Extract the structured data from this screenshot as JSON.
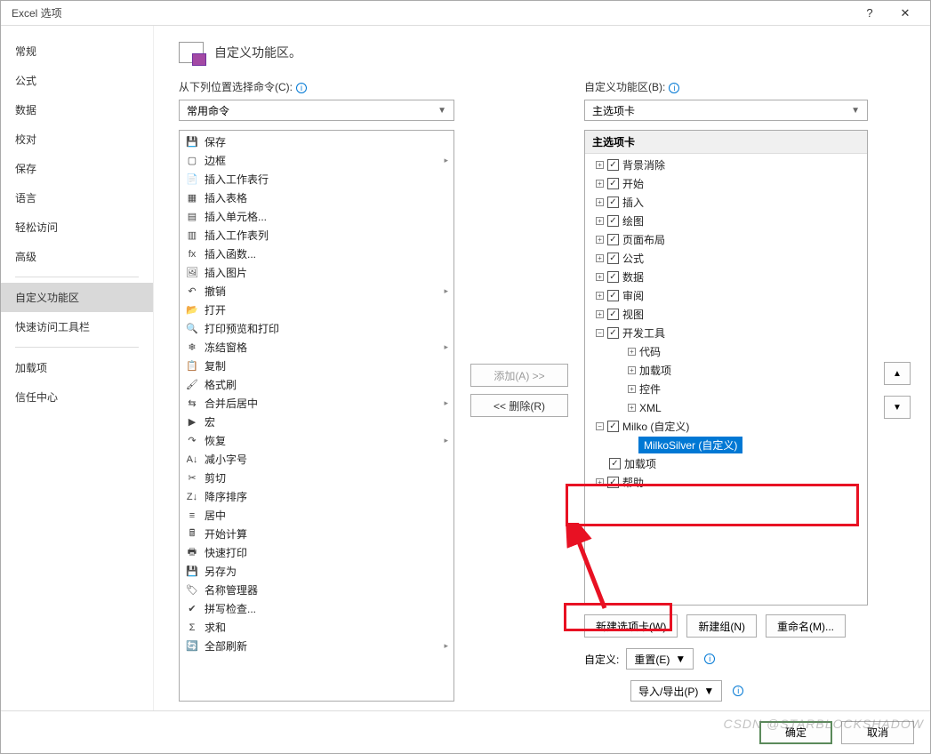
{
  "dialog": {
    "title": "Excel 选项",
    "help": "?",
    "close": "✕"
  },
  "sidebar": {
    "items": [
      "常规",
      "公式",
      "数据",
      "校对",
      "保存",
      "语言",
      "轻松访问",
      "高级"
    ],
    "items2": [
      "自定义功能区",
      "快速访问工具栏"
    ],
    "items3": [
      "加载项",
      "信任中心"
    ],
    "active": "自定义功能区"
  },
  "header": {
    "title": "自定义功能区。"
  },
  "left": {
    "label": "从下列位置选择命令(C):",
    "select": "常用命令",
    "commands": [
      {
        "icon": "💾",
        "text": "保存"
      },
      {
        "icon": "▢",
        "text": "边框",
        "more": true
      },
      {
        "icon": "📄",
        "text": "插入工作表行"
      },
      {
        "icon": "▦",
        "text": "插入表格"
      },
      {
        "icon": "▤",
        "text": "插入单元格..."
      },
      {
        "icon": "▥",
        "text": "插入工作表列"
      },
      {
        "icon": "fx",
        "text": "插入函数..."
      },
      {
        "icon": "🖼",
        "text": "插入图片"
      },
      {
        "icon": "↶",
        "text": "撤销",
        "more": true
      },
      {
        "icon": "📂",
        "text": "打开"
      },
      {
        "icon": "🔍",
        "text": "打印预览和打印"
      },
      {
        "icon": "❄",
        "text": "冻结窗格",
        "more": true
      },
      {
        "icon": "📋",
        "text": "复制"
      },
      {
        "icon": "🖌",
        "text": "格式刷"
      },
      {
        "icon": "⇆",
        "text": "合并后居中",
        "more": true
      },
      {
        "icon": "▶",
        "text": "宏"
      },
      {
        "icon": "↷",
        "text": "恢复",
        "more": true
      },
      {
        "icon": "A↓",
        "text": "减小字号"
      },
      {
        "icon": "✂",
        "text": "剪切"
      },
      {
        "icon": "Z↓",
        "text": "降序排序"
      },
      {
        "icon": "≡",
        "text": "居中"
      },
      {
        "icon": "🖩",
        "text": "开始计算"
      },
      {
        "icon": "🖶",
        "text": "快速打印"
      },
      {
        "icon": "💾",
        "text": "另存为"
      },
      {
        "icon": "🏷",
        "text": "名称管理器"
      },
      {
        "icon": "✔",
        "text": "拼写检查..."
      },
      {
        "icon": "Σ",
        "text": "求和"
      },
      {
        "icon": "🔄",
        "text": "全部刷新",
        "more": true
      }
    ]
  },
  "mid": {
    "add": "添加(A) >>",
    "remove": "<< 删除(R)"
  },
  "right": {
    "label": "自定义功能区(B):",
    "select": "主选项卡",
    "tree_header": "主选项卡",
    "tabs": [
      {
        "exp": "+",
        "chk": true,
        "text": "背景消除"
      },
      {
        "exp": "+",
        "chk": true,
        "text": "开始"
      },
      {
        "exp": "+",
        "chk": true,
        "text": "插入"
      },
      {
        "exp": "+",
        "chk": true,
        "text": "绘图"
      },
      {
        "exp": "+",
        "chk": true,
        "text": "页面布局"
      },
      {
        "exp": "+",
        "chk": true,
        "text": "公式"
      },
      {
        "exp": "+",
        "chk": true,
        "text": "数据"
      },
      {
        "exp": "+",
        "chk": true,
        "text": "审阅"
      },
      {
        "exp": "+",
        "chk": true,
        "text": "视图"
      }
    ],
    "dev": {
      "exp": "−",
      "chk": true,
      "text": "开发工具",
      "children": [
        "代码",
        "加载项",
        "控件",
        "XML"
      ]
    },
    "milko": {
      "exp": "−",
      "chk": true,
      "text": "Milko (自定义)",
      "child": "MilkoSilver (自定义)"
    },
    "after": [
      {
        "exp": "",
        "chk": true,
        "text": "加载项"
      },
      {
        "exp": "+",
        "chk": true,
        "text": "帮助"
      }
    ],
    "actions": {
      "new_tab": "新建选项卡(W)",
      "new_group": "新建组(N)",
      "rename": "重命名(M)..."
    },
    "custom_label": "自定义:",
    "reset": "重置(E)",
    "import": "导入/导出(P)"
  },
  "footer": {
    "ok": "确定",
    "cancel": "取消"
  },
  "watermark": "CSDN @STARBLOCKSHADOW"
}
